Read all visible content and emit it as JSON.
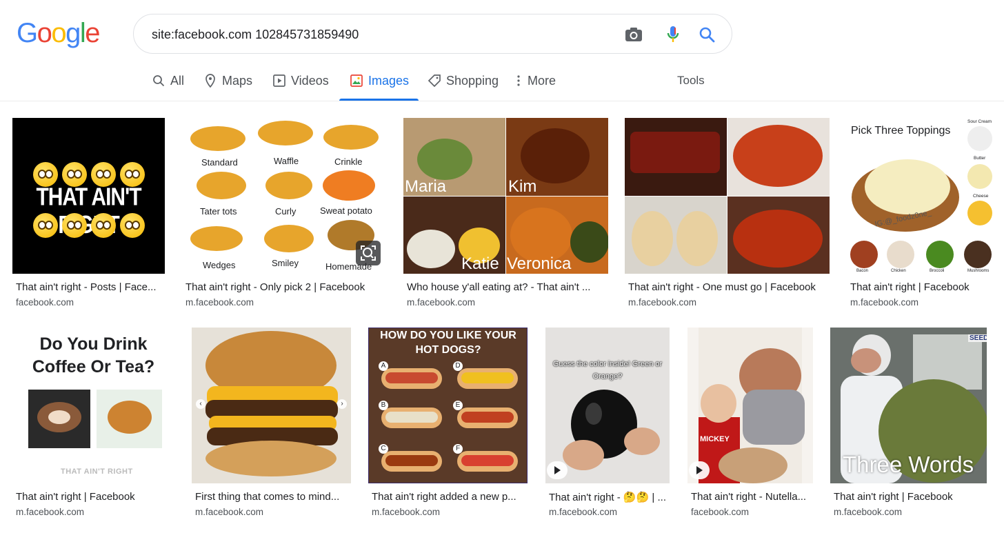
{
  "logo": {
    "letters": [
      "G",
      "o",
      "o",
      "g",
      "l",
      "e"
    ],
    "colors": [
      "#4285f4",
      "#ea4335",
      "#fbbc05",
      "#4285f4",
      "#34a853",
      "#ea4335"
    ]
  },
  "search": {
    "query": "site:facebook.com 102845731859490"
  },
  "icons": {
    "camera": "camera-icon",
    "mic": "microphone-icon",
    "search": "search-icon"
  },
  "tabs": [
    {
      "label": "All",
      "icon": "search-icon"
    },
    {
      "label": "Maps",
      "icon": "map-pin-icon"
    },
    {
      "label": "Videos",
      "icon": "video-icon"
    },
    {
      "label": "Images",
      "icon": "image-icon",
      "active": true
    },
    {
      "label": "Shopping",
      "icon": "tag-icon"
    },
    {
      "label": "More",
      "icon": "more-vert-icon"
    }
  ],
  "tools_label": "Tools",
  "accent": "#1a73e8",
  "results": [
    {
      "caption": "That ain't right - Posts | Face...",
      "source": "facebook.com",
      "overlay": "THAT AIN'T RIGHT"
    },
    {
      "caption": "That ain't right - Only pick 2 | Facebook",
      "source": "m.facebook.com",
      "overlay_labels": [
        "Standard",
        "Waffle",
        "Crinkle",
        "Tater tots",
        "Curly",
        "Sweat potato",
        "Wedges",
        "Smiley",
        "Homemade"
      ]
    },
    {
      "caption": "Who house y'all eating at? - That ain't ...",
      "source": "m.facebook.com",
      "overlay_labels": [
        "Maria",
        "Kim",
        "Katie",
        "Veronica"
      ]
    },
    {
      "caption": "That ain't right - One must go | Facebook",
      "source": "m.facebook.com"
    },
    {
      "caption": "That ain't right | Facebook",
      "source": "m.facebook.com",
      "overlay": "Pick Three Toppings",
      "overlay_small": [
        "Sour Cream",
        "Butter",
        "Cheese",
        "Bacon",
        "Chicken",
        "Broccoli",
        "Mushrooms"
      ],
      "watermark": "IG:@_foodz0ne_"
    },
    {
      "caption": "That ain't right | Facebook",
      "source": "m.facebook.com",
      "overlay": "Do You Drink Coffee Or Tea?",
      "footer": "THAT AIN'T RIGHT"
    },
    {
      "caption": "First thing that comes to mind...",
      "source": "m.facebook.com"
    },
    {
      "caption": "That ain't right added a new p...",
      "source": "m.facebook.com",
      "overlay": "HOW DO YOU LIKE YOUR HOT DOGS?",
      "overlay_labels": [
        "A",
        "B",
        "C",
        "D",
        "E",
        "F"
      ]
    },
    {
      "caption": "That ain't right - 🤔🤔 | ...",
      "source": "m.facebook.com",
      "overlay": "Guess the color inside! Green or Orange?"
    },
    {
      "caption": "That ain't right - Nutella...",
      "source": "facebook.com",
      "overlay": "MICKEY"
    },
    {
      "caption": "That ain't right | Facebook",
      "source": "m.facebook.com",
      "overlay": "Three Words",
      "overlay_small": [
        "SEED"
      ]
    }
  ]
}
